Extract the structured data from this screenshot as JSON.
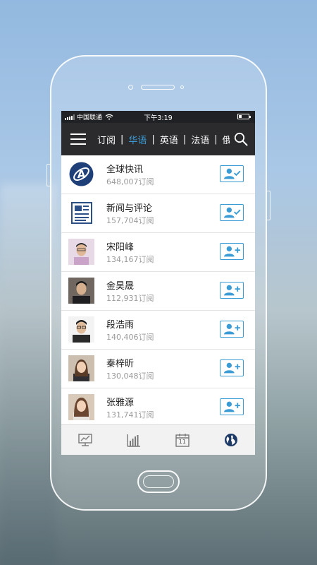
{
  "status": {
    "carrier": "中国联通",
    "time": "下午3:19"
  },
  "nav": {
    "tabs": [
      {
        "label": "订阅",
        "active": false
      },
      {
        "label": "华语",
        "active": true
      },
      {
        "label": "英语",
        "active": false
      },
      {
        "label": "法语",
        "active": false
      },
      {
        "label": "俄语",
        "active": false
      }
    ]
  },
  "colors": {
    "accent": "#3a9bd5",
    "navbar": "#2b2b2e"
  },
  "channels": [
    {
      "name": "全球快讯",
      "subscribers": "648,007订阅",
      "subscribed": true,
      "avatar_icon": "globe-logo-icon"
    },
    {
      "name": "新闻与评论",
      "subscribers": "157,704订阅",
      "subscribed": true,
      "avatar_icon": "newspaper-icon"
    },
    {
      "name": "宋阳峰",
      "subscribers": "134,167订阅",
      "subscribed": false,
      "avatar_icon": "person-photo"
    },
    {
      "name": "金昊晟",
      "subscribers": "112,931订阅",
      "subscribed": false,
      "avatar_icon": "person-photo"
    },
    {
      "name": "段浩雨",
      "subscribers": "140,406订阅",
      "subscribed": false,
      "avatar_icon": "person-photo"
    },
    {
      "name": "秦梓昕",
      "subscribers": "130,048订阅",
      "subscribed": false,
      "avatar_icon": "person-photo"
    },
    {
      "name": "张雅源",
      "subscribers": "131,741订阅",
      "subscribed": false,
      "avatar_icon": "person-photo"
    }
  ],
  "bottom_nav": [
    {
      "icon": "monitor-chart-icon",
      "active": false
    },
    {
      "icon": "bar-chart-icon",
      "active": false
    },
    {
      "icon": "calendar-icon",
      "label": "11",
      "active": false
    },
    {
      "icon": "globe-icon",
      "active": true
    }
  ]
}
